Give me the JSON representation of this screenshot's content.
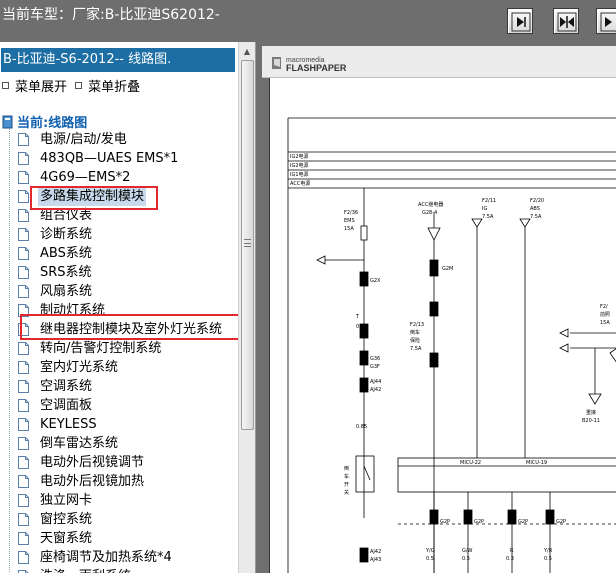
{
  "topbar": {
    "title": "当前车型：厂家:B-比亚迪S62012-",
    "buttons": [
      {
        "name": "first-page-button",
        "icon": "step-forward-icon"
      },
      {
        "name": "fit-page-button",
        "icon": "fit-width-icon"
      },
      {
        "name": "next-page-button",
        "icon": "forward-icon"
      }
    ]
  },
  "sidebar": {
    "doc_title": "B-比亚迪-S6-2012-- 线路图.",
    "expand_label": "菜单展开",
    "collapse_label": "菜单折叠",
    "root_label": "当前:线路图",
    "items": [
      {
        "label": "电源/启动/发电"
      },
      {
        "label": "483QB—UAES EMS*1"
      },
      {
        "label": "4G69—EMS*2"
      },
      {
        "label": "多路集成控制模块",
        "selected": true
      },
      {
        "label": "组合仪表"
      },
      {
        "label": "诊断系统"
      },
      {
        "label": "ABS系统"
      },
      {
        "label": "SRS系统"
      },
      {
        "label": "风扇系统"
      },
      {
        "label": "制动灯系统"
      },
      {
        "label": "继电器控制模块及室外灯光系统"
      },
      {
        "label": "转向/告警灯控制系统"
      },
      {
        "label": "室内灯光系统"
      },
      {
        "label": "空调系统"
      },
      {
        "label": "空调面板"
      },
      {
        "label": "KEYLESS"
      },
      {
        "label": "倒车雷达系统"
      },
      {
        "label": "电动外后视镜调节"
      },
      {
        "label": "电动外后视镜加热"
      },
      {
        "label": "独立网卡"
      },
      {
        "label": "窗控系统"
      },
      {
        "label": "天窗系统"
      },
      {
        "label": "座椅调节及加热系统*4"
      },
      {
        "label": "洗涤、雨刮系统"
      }
    ]
  },
  "viewer": {
    "logo_top": "macromedia",
    "logo_bottom": "FLASHPAPER",
    "diagram": {
      "bus_labels": [
        "IG2电源",
        "IG2电源",
        "IG1电源",
        "ACC电源"
      ],
      "fuse_1": [
        "F2/36",
        "EMS",
        "15A"
      ],
      "acc_relay": [
        "ACC继电器",
        "G28-4"
      ],
      "fuse_2": [
        "F2/11",
        "IG",
        "7.5A"
      ],
      "fuse_3": [
        "F2/20",
        "ABS",
        "7.5A"
      ],
      "fuse_4": [
        "F2/",
        "前照",
        "15A"
      ],
      "conn_g2x": "G2X",
      "conn_t7": "T",
      "wire_085": "0.85",
      "fuse_5": [
        "F2/13",
        "倒车",
        "保险",
        "7.5A"
      ],
      "conn_g2m": "G2M",
      "conn_g36": [
        "G36",
        "G3F"
      ],
      "conn_aj": [
        "AJ44",
        "AJ42"
      ],
      "switch_label": [
        "倒",
        "车",
        "开",
        "关"
      ],
      "conn_b20": [
        "重接",
        "B20-11"
      ],
      "module": [
        "MICU-22",
        "MICU-19"
      ],
      "bottom_conns": [
        "G2P",
        "G2P",
        "G2P",
        "G2P"
      ],
      "wire_colors": [
        "Y/G",
        "G/W",
        "R",
        "Y/R"
      ],
      "wire_sizes": [
        "0.5",
        "0.5",
        "0.3",
        "0.5"
      ],
      "bottom_aj": [
        "AJ42",
        "AJ43"
      ]
    }
  }
}
